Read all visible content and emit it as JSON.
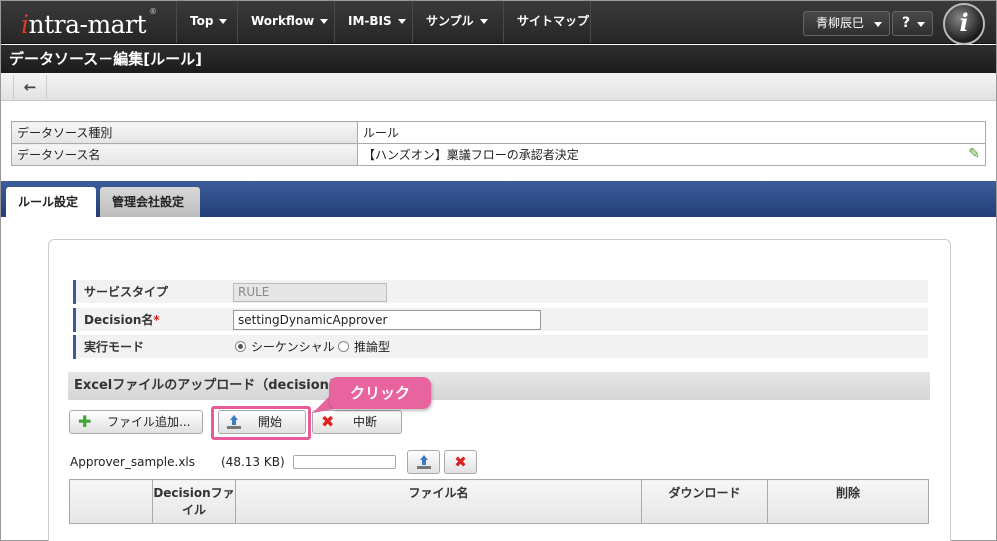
{
  "app": {
    "logo_text_i": "i",
    "logo_text_rest": "ntra-mart",
    "logo_reg": "®",
    "badge_letter": "i"
  },
  "nav": {
    "items": [
      {
        "label": "Top"
      },
      {
        "label": "Workflow"
      },
      {
        "label": "IM-BIS"
      },
      {
        "label": "サンプル"
      },
      {
        "label": "サイトマップ"
      }
    ],
    "user_name": "青柳辰巳",
    "help_label": "?"
  },
  "page": {
    "title": "データソース－編集[ルール]",
    "back_icon": "←"
  },
  "info": {
    "rows": [
      {
        "label": "データソース種別",
        "value": "ルール"
      },
      {
        "label": "データソース名",
        "value": "【ハンズオン】稟議フローの承認者決定"
      }
    ]
  },
  "tabs": [
    {
      "label": "ルール設定",
      "active": true
    },
    {
      "label": "管理会社設定",
      "active": false
    }
  ],
  "form": {
    "service_type_label": "サービスタイプ",
    "service_type_value": "RULE",
    "decision_label": "Decision名",
    "decision_required_mark": "*",
    "decision_value": "settingDynamicApprover",
    "mode_label": "実行モード",
    "mode_options": [
      "シーケンシャル",
      "推論型"
    ],
    "mode_selected": "シーケンシャル"
  },
  "upload": {
    "section_title": "Excelファイルのアップロード（decisionファ",
    "add_button": "ファイル追加...",
    "start_button": "開始",
    "cancel_button": "中断",
    "callout": "クリック",
    "file_name": "Approver_sample.xls",
    "file_size": "(48.13 KB)",
    "progress": 0,
    "table_headers": [
      "",
      "Decisionファイル",
      "ファイル名",
      "ダウンロード",
      "削除"
    ]
  },
  "colors": {
    "tab_bar": "#2d4c8a",
    "callout": "#e8649f",
    "accent_label_bar": "#3a5a95"
  }
}
